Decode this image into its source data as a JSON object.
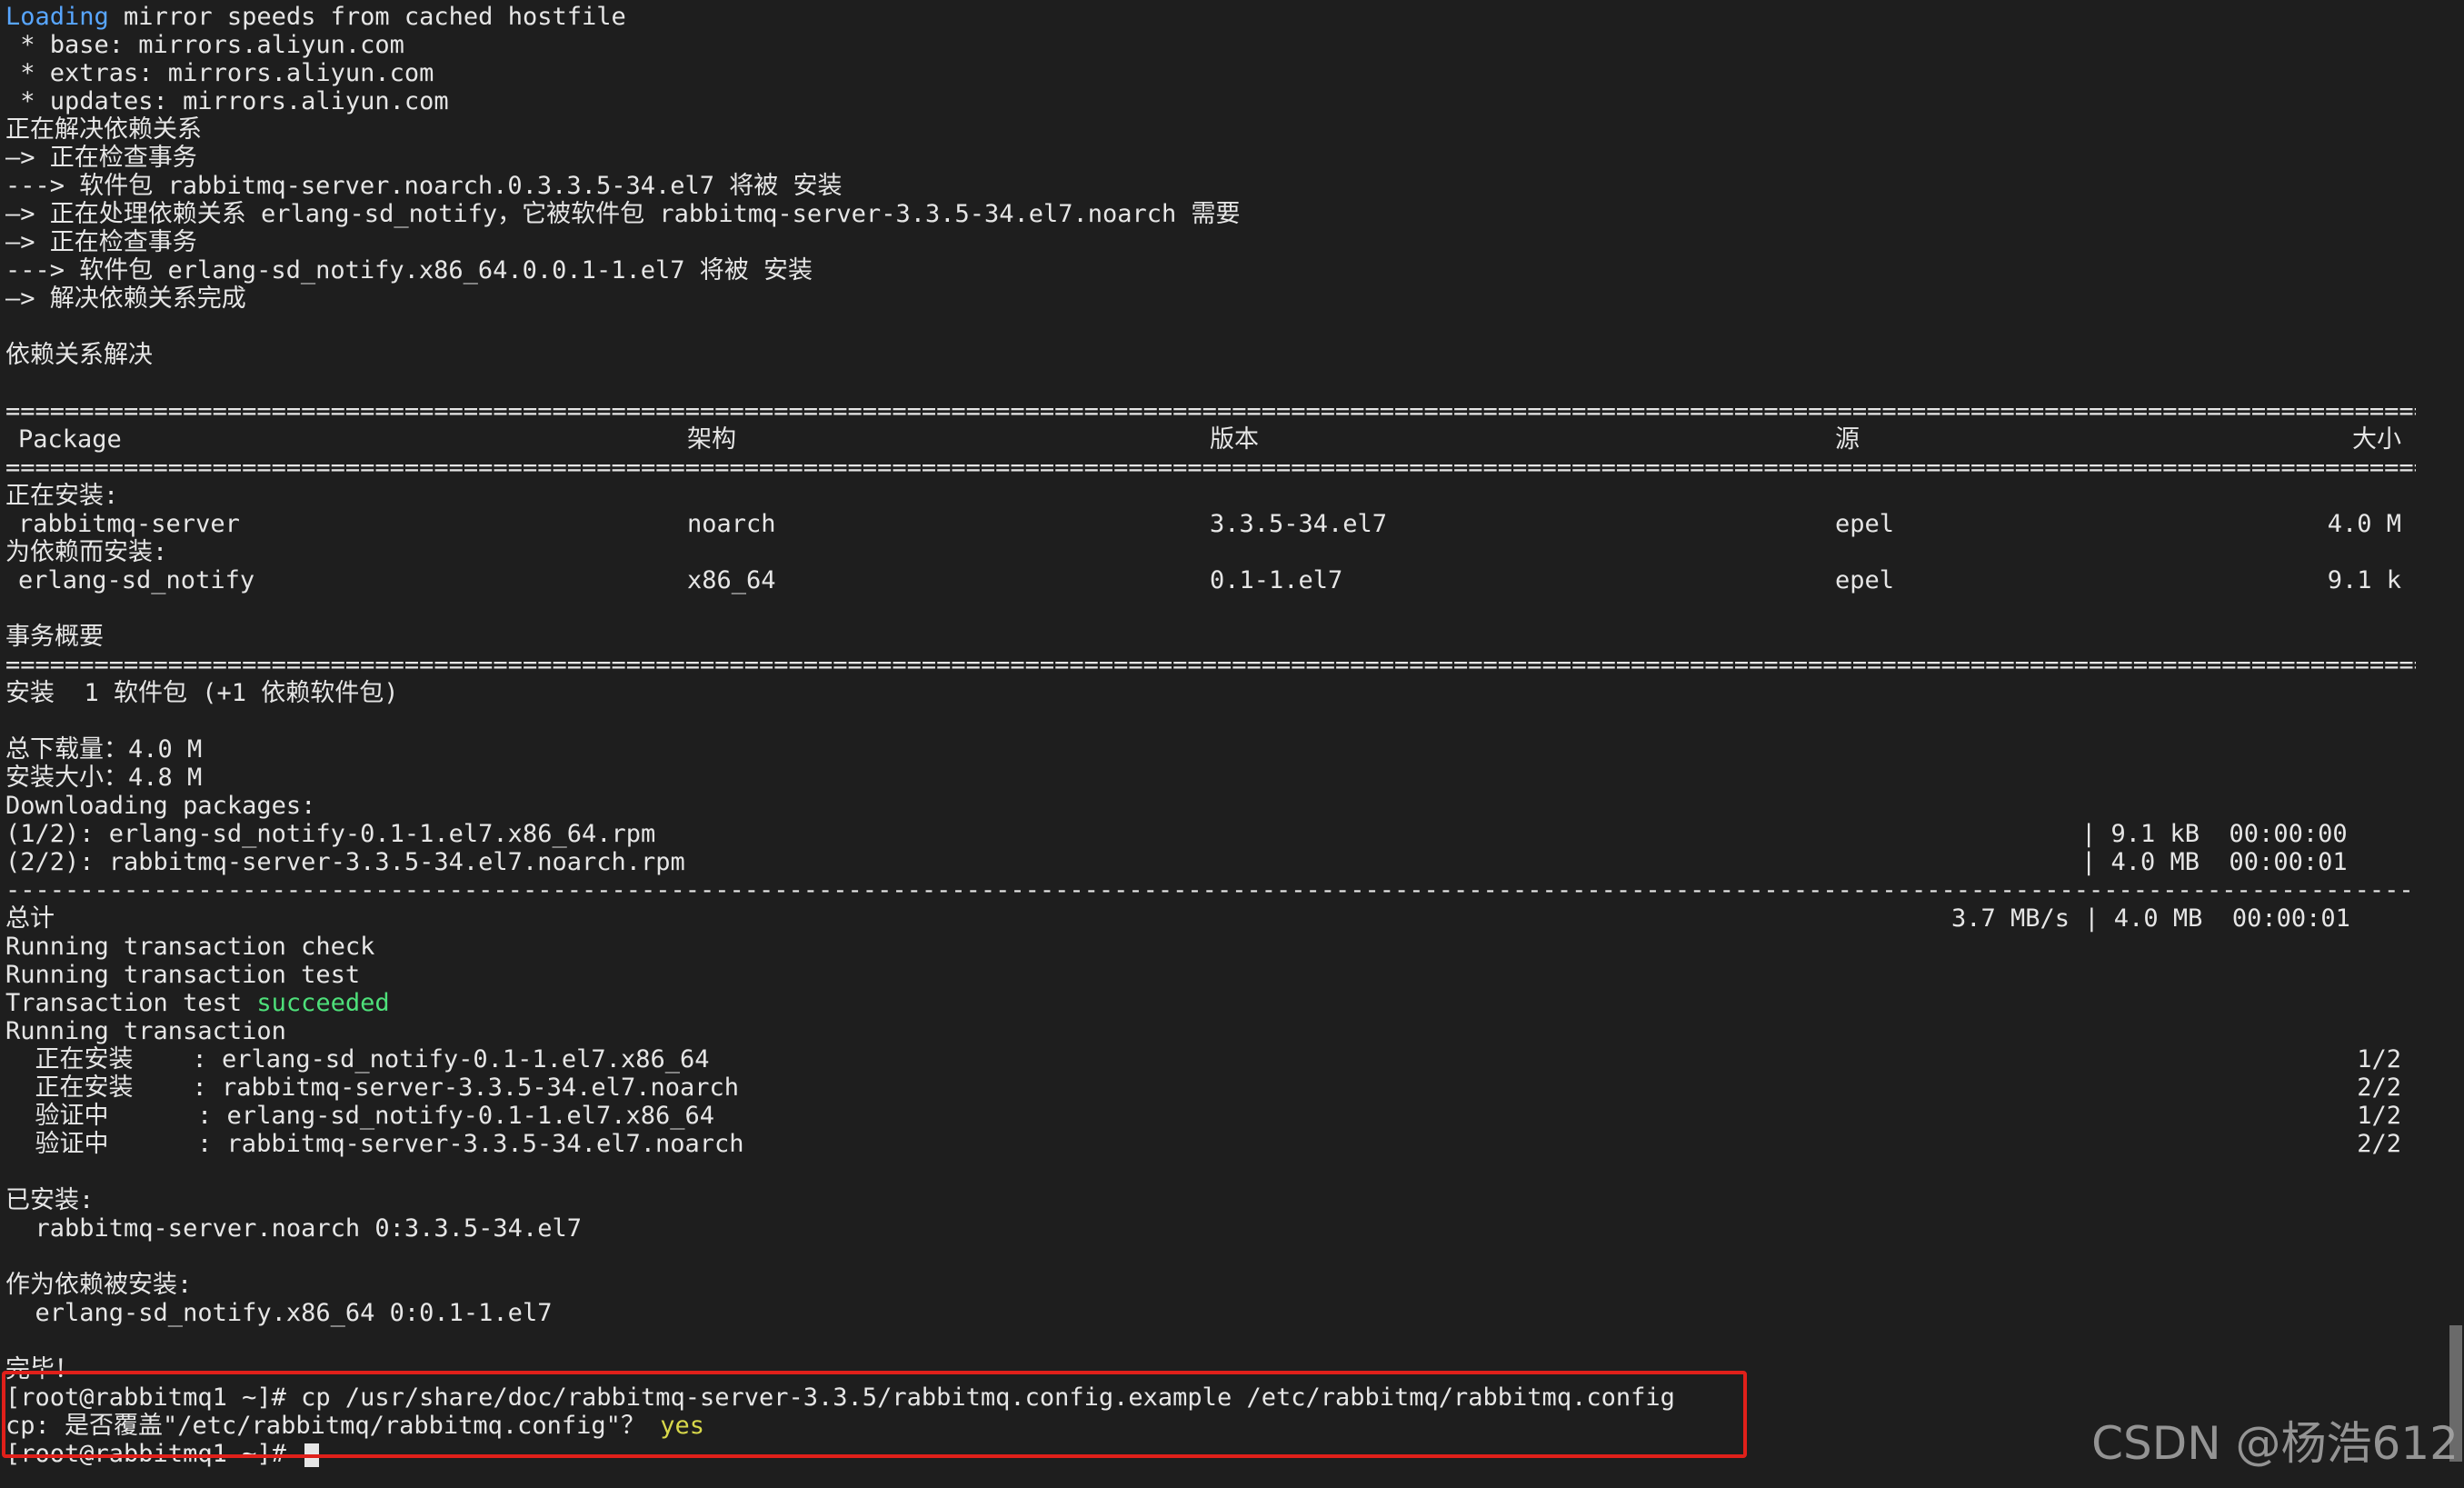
{
  "output": {
    "loading_word": "Loading",
    "loading_rest": " mirror speeds from cached hostfile",
    "base": " * base: mirrors.aliyun.com",
    "extras": " * extras: mirrors.aliyun.com",
    "updates": " * updates: mirrors.aliyun.com",
    "resolving": "正在解决依赖关系",
    "checking1": "—> 正在检查事务",
    "pkg1": "---> 软件包 rabbitmq-server.noarch.0.3.3.5-34.el7 将被 安装",
    "processing": "—> 正在处理依赖关系 erlang-sd_notify，它被软件包 rabbitmq-server-3.3.5-34.el7.noarch 需要",
    "checking2": "—> 正在检查事务",
    "pkg2": "---> 软件包 erlang-sd_notify.x86_64.0.0.1-1.el7 将被 安装",
    "resolved_done": "—> 解决依赖关系完成",
    "deps_resolved": "依赖关系解决"
  },
  "table": {
    "rule_double": "======================================================================================================================================================================================================================",
    "headers": {
      "package": "Package",
      "arch": "架构",
      "version": "版本",
      "repo": "源",
      "size": "大小"
    },
    "installing_label": "正在安装:",
    "dep_installing_label": "为依赖而安装:",
    "rows": [
      {
        "package": "rabbitmq-server",
        "arch": "noarch",
        "version": "3.3.5-34.el7",
        "repo": "epel",
        "size": "4.0 M"
      },
      {
        "package": "erlang-sd_notify",
        "arch": "x86_64",
        "version": "0.1-1.el7",
        "repo": "epel",
        "size": "9.1 k"
      }
    ],
    "summary_label": "事务概要"
  },
  "summary": {
    "install_line": "安装  1 软件包 (+1 依赖软件包)",
    "total_download": "总下载量：4.0 M",
    "install_size": "安装大小：4.8 M",
    "downloading": "Downloading packages:",
    "downloads": [
      {
        "name": "(1/2): erlang-sd_notify-0.1-1.el7.x86_64.rpm",
        "stats": "| 9.1 kB  00:00:00"
      },
      {
        "name": "(2/2): rabbitmq-server-3.3.5-34.el7.noarch.rpm",
        "stats": "| 4.0 MB  00:00:01"
      }
    ],
    "rule_dashed": "-------------------------------------------------------------------------------------------------------------------------------------------------------------------------------------------------------------------------",
    "total_label": "总计",
    "total_stats": "3.7 MB/s | 4.0 MB  00:00:01"
  },
  "transaction": {
    "check": "Running transaction check",
    "test": "Running transaction test",
    "test_result_prefix": "Transaction test ",
    "test_result_word": "succeeded",
    "running": "Running transaction",
    "steps": [
      {
        "label": "  正在安装    : erlang-sd_notify-0.1-1.el7.x86_64",
        "count": "1/2"
      },
      {
        "label": "  正在安装    : rabbitmq-server-3.3.5-34.el7.noarch",
        "count": "2/2"
      },
      {
        "label": "  验证中      : erlang-sd_notify-0.1-1.el7.x86_64",
        "count": "1/2"
      },
      {
        "label": "  验证中      : rabbitmq-server-3.3.5-34.el7.noarch",
        "count": "2/2"
      }
    ],
    "installed_label": "已安装:",
    "installed_pkg": "  rabbitmq-server.noarch 0:3.3.5-34.el7",
    "dep_installed_label": "作为依赖被安装:",
    "dep_installed_pkg": "  erlang-sd_notify.x86_64 0:0.1-1.el7",
    "complete": "完毕！"
  },
  "commands": {
    "cp_command": "[root@rabbitmq1 ~]# cp /usr/share/doc/rabbitmq-server-3.3.5/rabbitmq.config.example /etc/rabbitmq/rabbitmq.config",
    "overwrite_prompt": "cp: 是否覆盖\"/etc/rabbitmq/rabbitmq.config\"？ ",
    "overwrite_answer": "yes",
    "prompt": "[root@rabbitmq1 ~]# "
  },
  "watermark": "CSDN @杨浩612",
  "colors": {
    "background": "#1e1e1e",
    "text": "#e6e6e6",
    "loading": "#58a6ff",
    "succeeded": "#4ee07a",
    "answer": "#d8d84a",
    "highlight_border": "#e0201a"
  }
}
